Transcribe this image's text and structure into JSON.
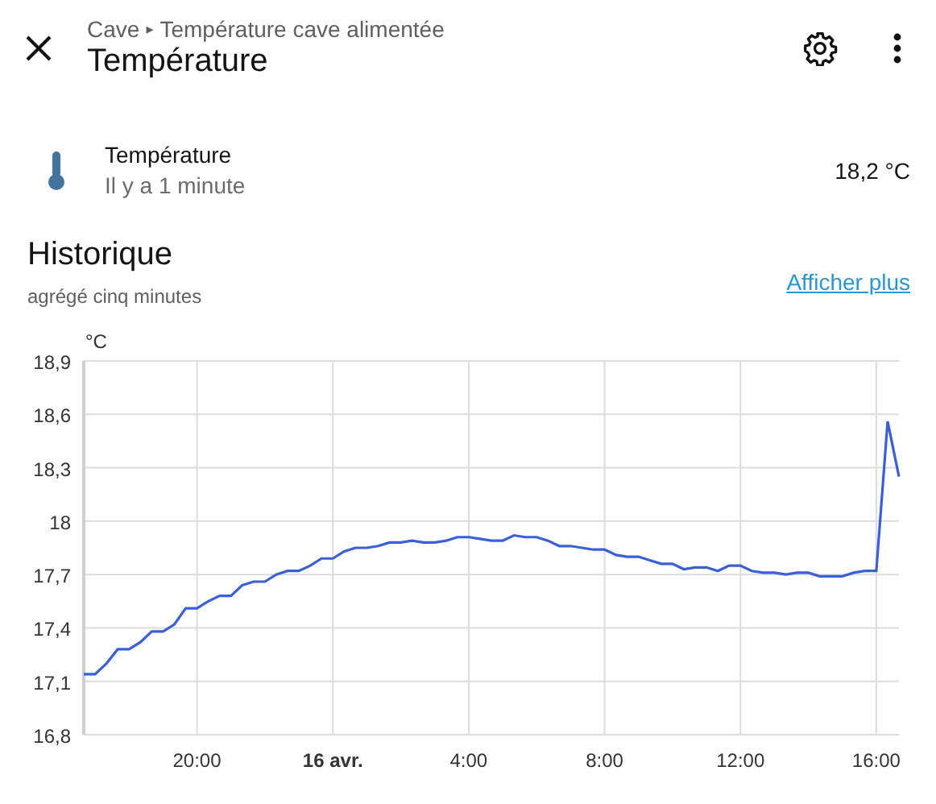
{
  "header": {
    "breadcrumb": [
      "Cave",
      "Température cave alimentée"
    ],
    "breadcrumb_separator": "▸",
    "title": "Température"
  },
  "entity": {
    "name": "Température",
    "last_changed": "Il y a 1 minute",
    "state": "18,2 °C"
  },
  "history": {
    "title": "Historique",
    "subtitle": "agrégé cinq minutes",
    "link": "Afficher plus",
    "chart_data": {
      "type": "line",
      "ylabel": "°C",
      "grid": true,
      "categories": [
        null,
        null,
        null,
        null,
        null,
        null,
        null,
        null,
        null,
        null,
        "20:00",
        null,
        null,
        null,
        null,
        null,
        null,
        null,
        null,
        null,
        null,
        null,
        "16 avr.",
        null,
        null,
        null,
        null,
        null,
        null,
        null,
        null,
        null,
        null,
        null,
        "4:00",
        null,
        null,
        null,
        null,
        null,
        null,
        null,
        null,
        null,
        null,
        null,
        "8:00",
        null,
        null,
        null,
        null,
        null,
        null,
        null,
        null,
        null,
        null,
        null,
        "12:00",
        null,
        null,
        null,
        null,
        null,
        null,
        null,
        null,
        null,
        null,
        null,
        "16:00",
        null,
        null
      ],
      "values": [
        17.14,
        17.14,
        17.2,
        17.28,
        17.28,
        17.32,
        17.38,
        17.38,
        17.42,
        17.51,
        17.51,
        17.55,
        17.58,
        17.58,
        17.64,
        17.66,
        17.66,
        17.7,
        17.72,
        17.72,
        17.75,
        17.79,
        17.79,
        17.83,
        17.85,
        17.85,
        17.86,
        17.88,
        17.88,
        17.89,
        17.88,
        17.88,
        17.89,
        17.91,
        17.91,
        17.9,
        17.89,
        17.89,
        17.92,
        17.91,
        17.91,
        17.89,
        17.86,
        17.86,
        17.85,
        17.84,
        17.84,
        17.81,
        17.8,
        17.8,
        17.78,
        17.76,
        17.76,
        17.73,
        17.74,
        17.74,
        17.72,
        17.75,
        17.75,
        17.72,
        17.71,
        17.71,
        17.7,
        17.71,
        17.71,
        17.69,
        17.69,
        17.69,
        17.71,
        17.72,
        17.72,
        18.56,
        18.25
      ],
      "ylim": [
        16.8,
        18.9
      ],
      "yticks": [
        {
          "value": 16.8,
          "label": "16,8"
        },
        {
          "value": 17.1,
          "label": "17,1"
        },
        {
          "value": 17.4,
          "label": "17,4"
        },
        {
          "value": 17.7,
          "label": "17,7"
        },
        {
          "value": 18,
          "label": "18"
        },
        {
          "value": 18.3,
          "label": "18,3"
        },
        {
          "value": 18.6,
          "label": "18,6"
        },
        {
          "value": 18.9,
          "label": "18,9"
        }
      ]
    }
  }
}
